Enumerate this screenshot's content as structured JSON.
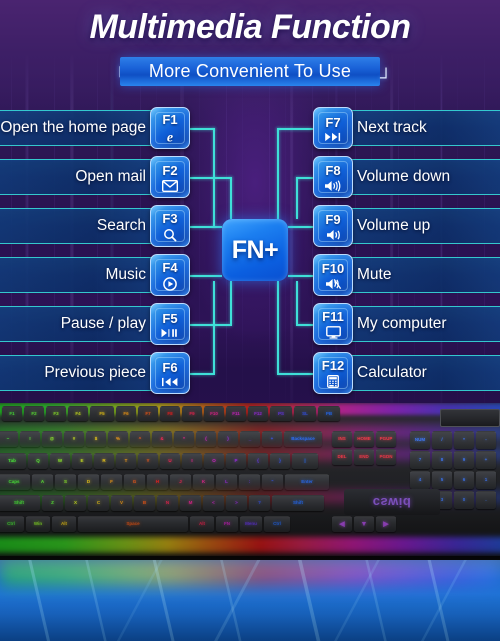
{
  "header": {
    "title": "Multimedia Function",
    "subtitle": "More Convenient To Use",
    "bracket_left": "┌",
    "bracket_right": "┘"
  },
  "center": {
    "fn_label": "FN+"
  },
  "left_items": [
    {
      "key": "F1",
      "label": "Open the home page",
      "icon": "internet-explorer-icon"
    },
    {
      "key": "F2",
      "label": "Open mail",
      "icon": "envelope-icon"
    },
    {
      "key": "F3",
      "label": "Search",
      "icon": "magnifier-icon"
    },
    {
      "key": "F4",
      "label": "Music",
      "icon": "play-circle-icon"
    },
    {
      "key": "F5",
      "label": "Pause / play",
      "icon": "play-pause-icon"
    },
    {
      "key": "F6",
      "label": "Previous piece",
      "icon": "previous-track-icon"
    }
  ],
  "right_items": [
    {
      "key": "F7",
      "label": "Next track",
      "icon": "next-track-icon"
    },
    {
      "key": "F8",
      "label": "Volume down",
      "icon": "volume-down-icon"
    },
    {
      "key": "F9",
      "label": "Volume up",
      "icon": "volume-up-icon"
    },
    {
      "key": "F10",
      "label": "Mute",
      "icon": "volume-mute-icon"
    },
    {
      "key": "F11",
      "label": "My computer",
      "icon": "monitor-icon"
    },
    {
      "key": "F12",
      "label": "Calculator",
      "icon": "calculator-icon"
    }
  ],
  "keyboard": {
    "brand": "cswid",
    "row_fn": [
      "F1",
      "F2",
      "F3",
      "F4",
      "F5",
      "F6",
      "F7",
      "F8",
      "F9",
      "F10",
      "F11",
      "F12",
      "PS",
      "SL",
      "PB"
    ],
    "row_num": [
      "~",
      "!",
      "@",
      "#",
      "$",
      "%",
      "^",
      "&",
      "*",
      "(",
      ")",
      "_",
      "+",
      "Backspace"
    ],
    "row_q": [
      "Tab",
      "Q",
      "W",
      "E",
      "R",
      "T",
      "Y",
      "U",
      "I",
      "O",
      "P",
      "{",
      "}",
      "|"
    ],
    "row_a": [
      "Caps",
      "A",
      "S",
      "D",
      "F",
      "G",
      "H",
      "J",
      "K",
      "L",
      ":",
      "\"",
      "Enter"
    ],
    "row_z": [
      "Shift",
      "Z",
      "X",
      "C",
      "V",
      "B",
      "N",
      "M",
      "<",
      ">",
      "?",
      "Shift"
    ],
    "row_ctl": [
      "Ctrl",
      "Win",
      "Alt",
      "Space",
      "Alt",
      "FN",
      "Menu",
      "Ctrl"
    ],
    "nav_keys": [
      "INS",
      "HOME",
      "PGUP",
      "DEL",
      "END",
      "PGDN"
    ],
    "arrow_up": "▲",
    "arrow_down": "▼",
    "arrow_left": "◀",
    "arrow_right": "▶",
    "numpad": [
      "NUM",
      "/",
      "*",
      "-",
      "7",
      "8",
      "9",
      "+",
      "4",
      "5",
      "6",
      "1",
      "2",
      "3",
      "0",
      "."
    ]
  },
  "colors": {
    "accent_cyan": "#3fe0d8",
    "band_blue": "#10386f",
    "key_blue": "#0f5fd8",
    "brand_purple": "#8d5bd6",
    "bg_purple": "#2b1552"
  }
}
